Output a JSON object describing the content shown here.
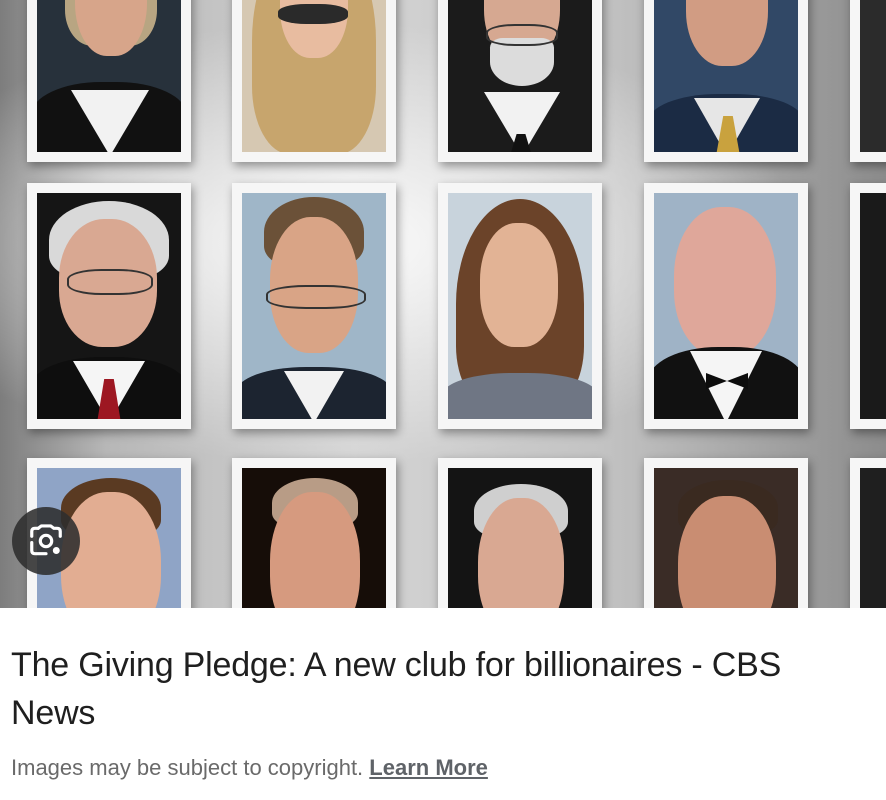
{
  "image": {
    "alt": "",
    "lens_icon": "google-lens-icon"
  },
  "result": {
    "title": "The Giving Pledge: A new club for billionaires - CBS News",
    "copyright_text": "Images may be subject to copyright.",
    "learn_more_label": "Learn More"
  },
  "colors": {
    "title_text": "#1f1f1f",
    "muted_text": "#6a6a6a",
    "link_text": "#5f6368",
    "lens_button_bg": "#2d2d2d"
  }
}
